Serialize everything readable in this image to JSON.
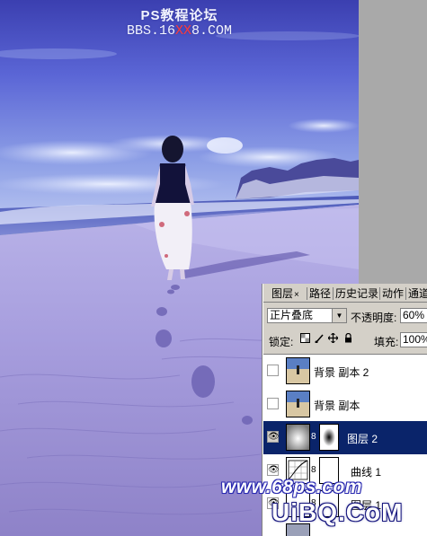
{
  "watermark": {
    "title": "PS教程论坛",
    "url_prefix": "BBS.16",
    "url_red": "XX",
    "url_suffix": "8.COM",
    "site68": "www.68ps.com",
    "uibq": "UiBQ.CoM"
  },
  "layers_panel": {
    "tabs": [
      {
        "label": "图层",
        "close": "×"
      },
      {
        "label": "路径"
      },
      {
        "label": "历史记录"
      },
      {
        "label": "动作"
      },
      {
        "label": "通道"
      }
    ],
    "blend_mode": "正片叠底",
    "opacity_label": "不透明度:",
    "opacity_value": "60%",
    "lock_label": "锁定:",
    "fill_label": "填充:",
    "fill_value": "100%",
    "layers": [
      {
        "name": "背景 副本 2",
        "visible": false,
        "selected": false
      },
      {
        "name": "背景 副本",
        "visible": false,
        "selected": false
      },
      {
        "name": "图层 2",
        "visible": true,
        "selected": true
      },
      {
        "name": "曲线 1",
        "visible": true,
        "selected": false
      },
      {
        "name": "图层 1",
        "visible": true,
        "selected": false
      }
    ]
  },
  "colors": {
    "selection": "#0a246a",
    "panel_bg": "#d4d0c8",
    "accent_red": "#ff3a3a"
  }
}
